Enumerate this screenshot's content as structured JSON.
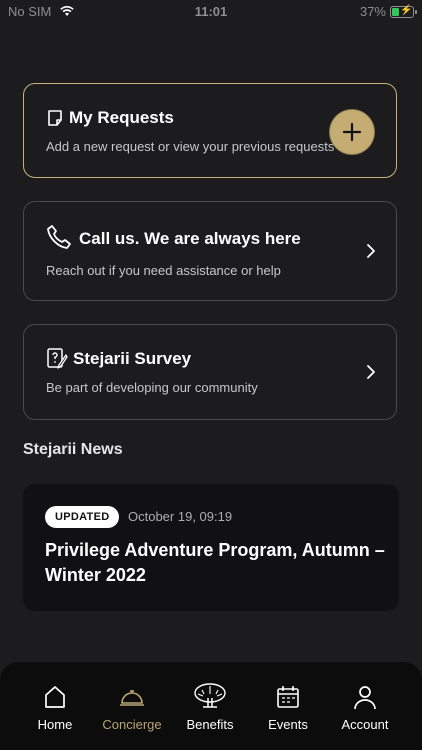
{
  "status_bar": {
    "carrier": "No SIM",
    "time": "11:01",
    "battery": "37%",
    "battery_level": 0.37
  },
  "cards": {
    "requests": {
      "title": "My Requests",
      "subtitle": "Add a new request or view your previous requests",
      "icon": "note-icon"
    },
    "call": {
      "title": "Call us. We are always here",
      "subtitle": "Reach out if you need assistance or help",
      "icon": "phone-icon"
    },
    "survey": {
      "title": "Stejarii Survey",
      "subtitle": "Be part of developing our community",
      "icon": "survey-icon"
    }
  },
  "news": {
    "section_title": "Stejarii News",
    "badge": "UPDATED",
    "date": "October 19, 09:19",
    "title": "Privilege Adventure Program, Autumn – Winter 2022"
  },
  "tabs": [
    {
      "label": "Home",
      "icon": "home-icon"
    },
    {
      "label": "Concierge",
      "icon": "bell-icon",
      "active": true
    },
    {
      "label": "Benefits",
      "icon": "tree-icon"
    },
    {
      "label": "Events",
      "icon": "calendar-icon"
    },
    {
      "label": "Account",
      "icon": "person-icon"
    }
  ],
  "colors": {
    "accent": "#c4ac72",
    "background": "#1c1c1e",
    "active_tab": "#b8a572"
  }
}
